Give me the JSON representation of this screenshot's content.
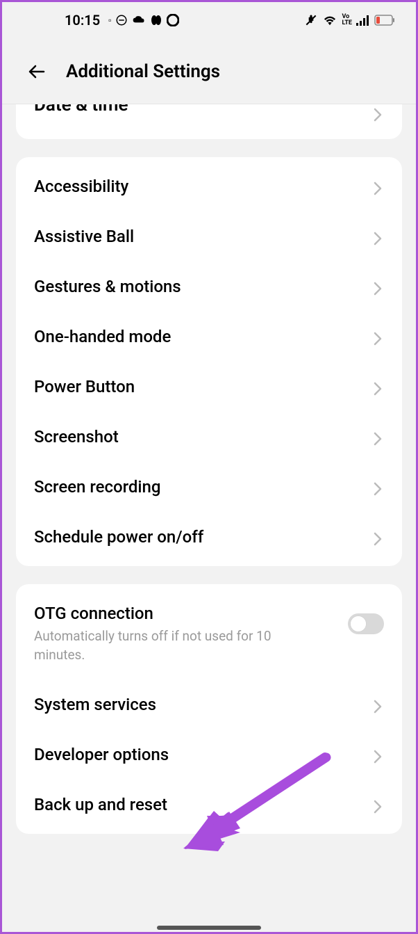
{
  "status": {
    "time": "10:15"
  },
  "header": {
    "title": "Additional Settings"
  },
  "groups": [
    {
      "cutoff_item": {
        "label": "Date & time"
      }
    },
    {
      "items": [
        {
          "label": "Accessibility"
        },
        {
          "label": "Assistive Ball"
        },
        {
          "label": "Gestures & motions"
        },
        {
          "label": "One-handed mode"
        },
        {
          "label": "Power Button"
        },
        {
          "label": "Screenshot"
        },
        {
          "label": "Screen recording"
        },
        {
          "label": "Schedule power on/off"
        }
      ]
    },
    {
      "items": [
        {
          "label": "OTG connection",
          "sub": "Automatically turns off if not used for 10 minutes.",
          "toggle": false
        },
        {
          "label": "System services"
        },
        {
          "label": "Developer options"
        },
        {
          "label": "Back up and reset"
        }
      ]
    }
  ]
}
